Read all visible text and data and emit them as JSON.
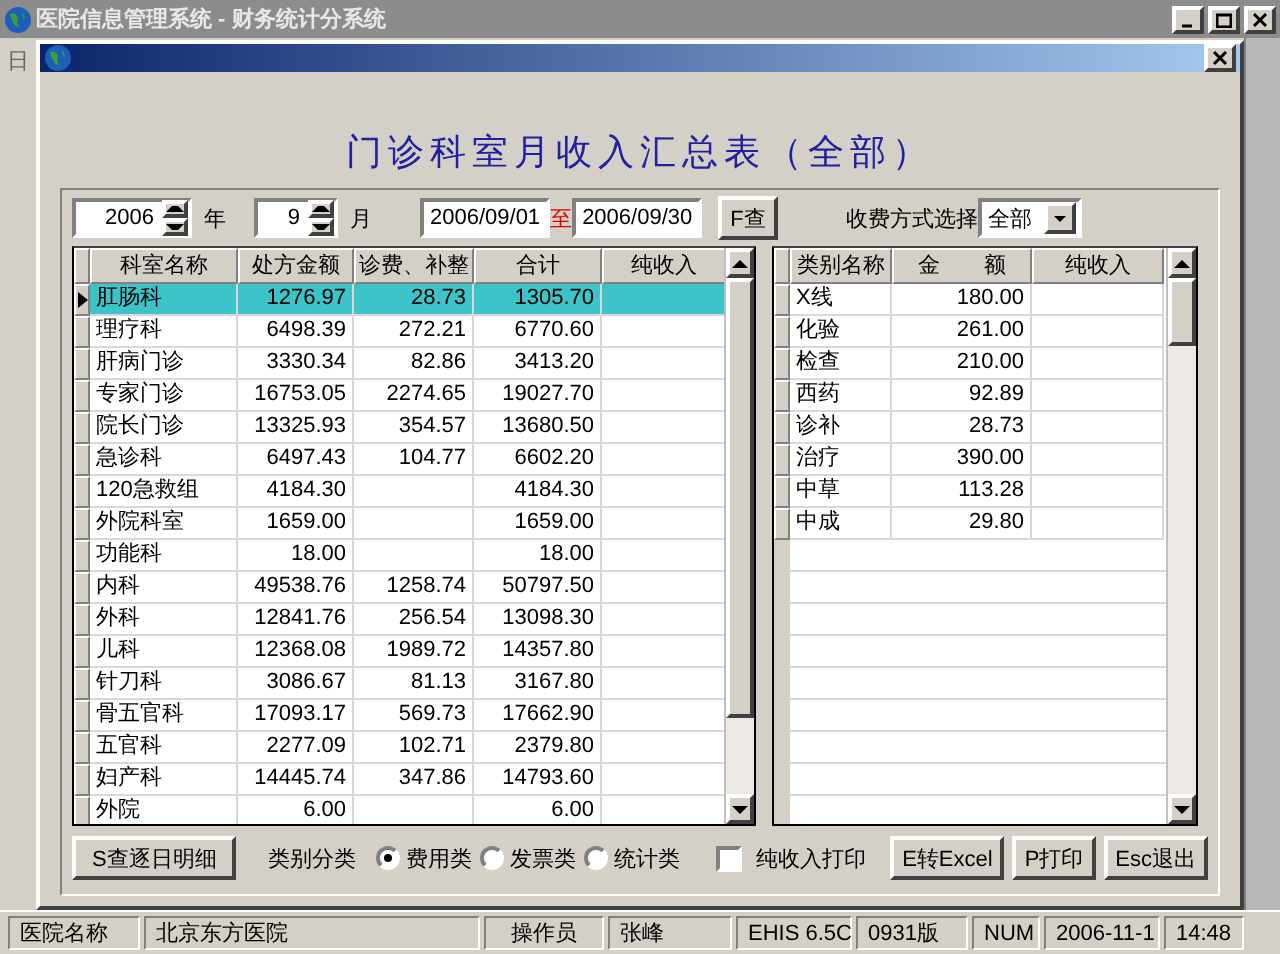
{
  "window": {
    "title": "医院信息管理系统 - 财务统计分系统",
    "menu_glyph": "日"
  },
  "report": {
    "title": "门诊科室月收入汇总表（全部）"
  },
  "filters": {
    "year": "2006",
    "year_label": "年",
    "month": "9",
    "month_label": "月",
    "date_from": "2006/09/01",
    "date_separator": "至",
    "date_to": "2006/09/30",
    "query_button": "F查",
    "payment_label": "收费方式选择",
    "payment_value": "全部"
  },
  "department_table": {
    "columns": [
      "科室名称",
      "处方金额",
      "诊费、补整",
      "合计",
      "纯收入"
    ],
    "rows": [
      {
        "cells": [
          "肛肠科",
          "1276.97",
          "28.73",
          "1305.70",
          ""
        ],
        "selected": true
      },
      {
        "cells": [
          "理疗科",
          "6498.39",
          "272.21",
          "6770.60",
          ""
        ],
        "selected": false
      },
      {
        "cells": [
          "肝病门诊",
          "3330.34",
          "82.86",
          "3413.20",
          ""
        ],
        "selected": false
      },
      {
        "cells": [
          "专家门诊",
          "16753.05",
          "2274.65",
          "19027.70",
          ""
        ],
        "selected": false
      },
      {
        "cells": [
          "院长门诊",
          "13325.93",
          "354.57",
          "13680.50",
          ""
        ],
        "selected": false
      },
      {
        "cells": [
          "急诊科",
          "6497.43",
          "104.77",
          "6602.20",
          ""
        ],
        "selected": false
      },
      {
        "cells": [
          "120急救组",
          "4184.30",
          "",
          "4184.30",
          ""
        ],
        "selected": false
      },
      {
        "cells": [
          "外院科室",
          "1659.00",
          "",
          "1659.00",
          ""
        ],
        "selected": false
      },
      {
        "cells": [
          "功能科",
          "18.00",
          "",
          "18.00",
          ""
        ],
        "selected": false
      },
      {
        "cells": [
          "内科",
          "49538.76",
          "1258.74",
          "50797.50",
          ""
        ],
        "selected": false
      },
      {
        "cells": [
          "外科",
          "12841.76",
          "256.54",
          "13098.30",
          ""
        ],
        "selected": false
      },
      {
        "cells": [
          "儿科",
          "12368.08",
          "1989.72",
          "14357.80",
          ""
        ],
        "selected": false
      },
      {
        "cells": [
          "针刀科",
          "3086.67",
          "81.13",
          "3167.80",
          ""
        ],
        "selected": false
      },
      {
        "cells": [
          "骨五官科",
          "17093.17",
          "569.73",
          "17662.90",
          ""
        ],
        "selected": false
      },
      {
        "cells": [
          "五官科",
          "2277.09",
          "102.71",
          "2379.80",
          ""
        ],
        "selected": false
      },
      {
        "cells": [
          "妇产科",
          "14445.74",
          "347.86",
          "14793.60",
          ""
        ],
        "selected": false
      },
      {
        "cells": [
          "外院",
          "6.00",
          "",
          "6.00",
          ""
        ],
        "selected": false
      }
    ]
  },
  "category_table": {
    "columns": [
      "类别名称",
      "金　　额",
      "纯收入"
    ],
    "rows": [
      {
        "cells": [
          "X线",
          "180.00",
          ""
        ],
        "selected": false
      },
      {
        "cells": [
          "化验",
          "261.00",
          ""
        ],
        "selected": false
      },
      {
        "cells": [
          "检查",
          "210.00",
          ""
        ],
        "selected": false
      },
      {
        "cells": [
          "西药",
          "92.89",
          ""
        ],
        "selected": false
      },
      {
        "cells": [
          "诊补",
          "28.73",
          ""
        ],
        "selected": false
      },
      {
        "cells": [
          "治疗",
          "390.00",
          ""
        ],
        "selected": false
      },
      {
        "cells": [
          "中草",
          "113.28",
          ""
        ],
        "selected": false
      },
      {
        "cells": [
          "中成",
          "29.80",
          ""
        ],
        "selected": false
      }
    ]
  },
  "bottom_bar": {
    "detail_button": "S查逐日明细",
    "category_label": "类别分类",
    "radios": [
      {
        "label": "费用类",
        "selected": true
      },
      {
        "label": "发票类",
        "selected": false
      },
      {
        "label": "统计类",
        "selected": false
      }
    ],
    "net_income_print": {
      "label": "纯收入打印",
      "checked": false
    },
    "buttons": [
      "E转Excel",
      "P打印",
      "Esc退出"
    ]
  },
  "status_bar": [
    "医院名称",
    "北京东方医院",
    "操作员",
    "张峰",
    "EHIS 6.5C",
    "0931版",
    "NUM",
    "2006-11-1",
    "14:48"
  ]
}
